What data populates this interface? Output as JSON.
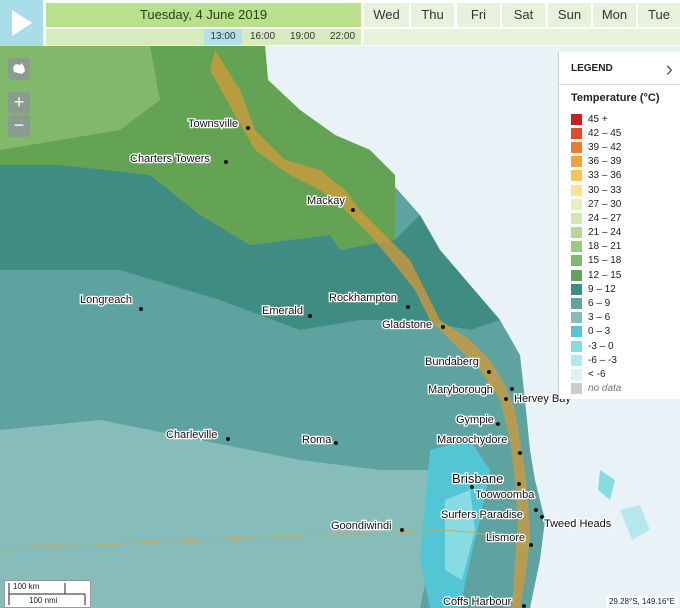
{
  "header": {
    "date": "Tuesday, 4 June 2019",
    "days": [
      "Wed",
      "Thu",
      "Fri",
      "Sat",
      "Sun",
      "Mon",
      "Tue"
    ],
    "times": [
      "13:00",
      "16:00",
      "19:00",
      "22:00"
    ],
    "active_time": "13:00"
  },
  "controls": {
    "zoom_in": "+",
    "zoom_out": "−"
  },
  "legend": {
    "title": "LEGEND",
    "subtitle": "Temperature (°C)",
    "items": [
      {
        "label": "45 +",
        "color": "#c8201e"
      },
      {
        "label": "42 – 45",
        "color": "#e24b2a"
      },
      {
        "label": "39 – 42",
        "color": "#ef7b2d"
      },
      {
        "label": "36 – 39",
        "color": "#f3a33a"
      },
      {
        "label": "33 – 36",
        "color": "#f6c74e"
      },
      {
        "label": "30 – 33",
        "color": "#f7e591"
      },
      {
        "label": "27 – 30",
        "color": "#e6efc4"
      },
      {
        "label": "24 – 27",
        "color": "#d2e6b5"
      },
      {
        "label": "21 – 24",
        "color": "#b7d79a"
      },
      {
        "label": "18 – 21",
        "color": "#9dc883"
      },
      {
        "label": "15 – 18",
        "color": "#82b86a"
      },
      {
        "label": "12 – 15",
        "color": "#64a254"
      },
      {
        "label": "9 – 12",
        "color": "#3f8c82"
      },
      {
        "label": "6 – 9",
        "color": "#5fa3a0"
      },
      {
        "label": "3 – 6",
        "color": "#86bdbb"
      },
      {
        "label": "0 – 3",
        "color": "#53c6d6"
      },
      {
        "label": "-3 – 0",
        "color": "#87dce4"
      },
      {
        "label": "-6 – -3",
        "color": "#b5e8ee"
      },
      {
        "label": "< -6",
        "color": "#dbf3f6"
      },
      {
        "label": "no data",
        "color": "#cccccc"
      }
    ]
  },
  "towns": [
    {
      "name": "Townsville"
    },
    {
      "name": "Charters Towers"
    },
    {
      "name": "Mackay"
    },
    {
      "name": "Longreach"
    },
    {
      "name": "Emerald"
    },
    {
      "name": "Rockhampton"
    },
    {
      "name": "Gladstone"
    },
    {
      "name": "Bundaberg"
    },
    {
      "name": "Maryborough"
    },
    {
      "name": "Hervey Bay"
    },
    {
      "name": "Gympie"
    },
    {
      "name": "Charleville"
    },
    {
      "name": "Roma"
    },
    {
      "name": "Maroochydore"
    },
    {
      "name": "Brisbane"
    },
    {
      "name": "Toowoomba"
    },
    {
      "name": "Surfers Paradise"
    },
    {
      "name": "Tweed Heads"
    },
    {
      "name": "Goondiwindi"
    },
    {
      "name": "Lismore"
    },
    {
      "name": "Coffs Harbour"
    }
  ],
  "scale": {
    "km": "100 km",
    "nmi": "100 nmi"
  },
  "coordinates": "29.28°S, 149.16°E"
}
